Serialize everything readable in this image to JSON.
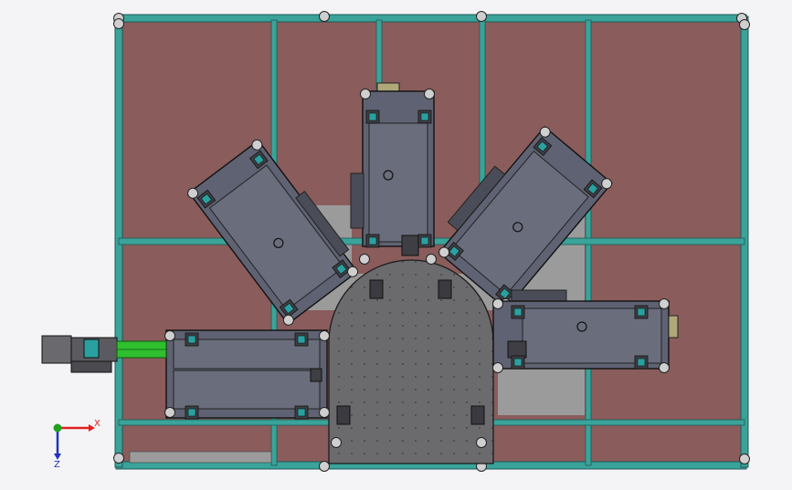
{
  "viewport": {
    "background": "#f4f4f6",
    "colors": {
      "frame_beam": "#3aa39a",
      "frame_beam_dark": "#1d5a55",
      "panel": "#8a5c5c",
      "plate": "#5f6272",
      "plate_dark": "#3c3f4a",
      "base_plate": "#6b6b6e",
      "conveyor": "#2fbf2f",
      "motor": "#2aa0a0",
      "gray_floor": "#9a9a9a",
      "bolt": "#c8c8c8"
    }
  },
  "triad": {
    "x_label": "X",
    "z_label": "Z",
    "x_color": "#e02020",
    "y_color": "#20a020",
    "z_color": "#2030c0"
  }
}
